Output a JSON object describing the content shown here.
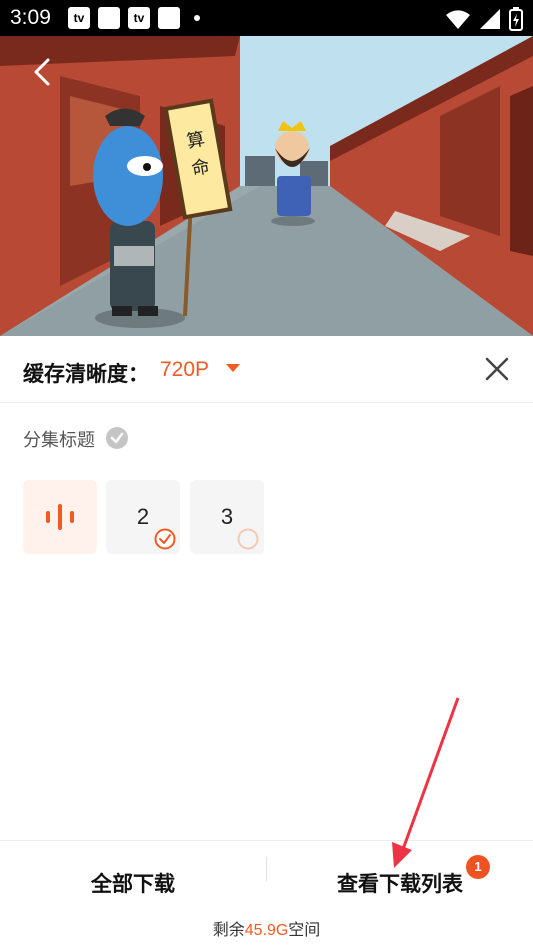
{
  "status_bar": {
    "time": "3:09",
    "notif_icons": [
      "tv-icon",
      "square-icon",
      "tv-icon",
      "square-icon"
    ]
  },
  "video": {
    "watermark_left": "",
    "watermark_right": "",
    "sign_text": "算命"
  },
  "panel": {
    "resolution_label": "缓存清晰度：",
    "resolution_value": "720P",
    "section_title": "分集标题",
    "episodes": [
      {
        "label": "",
        "state": "playing"
      },
      {
        "label": "2",
        "state": "downloaded"
      },
      {
        "label": "3",
        "state": "pending"
      }
    ]
  },
  "bottom": {
    "download_all": "全部下载",
    "view_list": "查看下载列表",
    "badge_count": "1",
    "storage_prefix": "剩余",
    "storage_value": "45.9G",
    "storage_suffix": "空间"
  },
  "colors": {
    "accent": "#f15a22",
    "badge": "#f05323"
  }
}
